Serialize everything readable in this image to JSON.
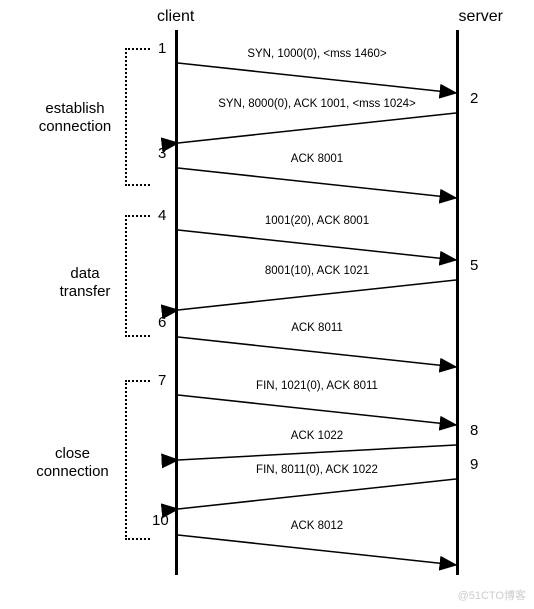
{
  "headers": {
    "client": "client",
    "server": "server"
  },
  "phases": {
    "establish": "establish connection",
    "data": "data transfer",
    "close": "close connection"
  },
  "steps": {
    "n1": "1",
    "n2": "2",
    "n3": "3",
    "n4": "4",
    "n5": "5",
    "n6": "6",
    "n7": "7",
    "n8": "8",
    "n9": "9",
    "n10": "10"
  },
  "messages": {
    "m1": "SYN, 1000(0), <mss 1460>",
    "m2": "SYN, 8000(0), ACK 1001, <mss 1024>",
    "m3": "ACK 8001",
    "m4": "1001(20), ACK 8001",
    "m5": "8001(10), ACK 1021",
    "m6": "ACK 8011",
    "m7": "FIN, 1021(0), ACK 8011",
    "m8": "ACK 1022",
    "m9": "FIN, 8011(0), ACK 1022",
    "m10": "ACK 8012"
  },
  "watermark": "@51CTO博客",
  "chart_data": {
    "type": "sequence-diagram",
    "title": "TCP Connection Lifecycle",
    "participants": [
      "client",
      "server"
    ],
    "phases": [
      {
        "name": "establish connection",
        "messages": [
          {
            "step": 1,
            "from": "client",
            "to": "server",
            "text": "SYN, 1000(0), <mss 1460>"
          },
          {
            "step": 2,
            "from": "server",
            "to": "client",
            "text": "SYN, 8000(0), ACK 1001, <mss 1024>"
          },
          {
            "step": 3,
            "from": "client",
            "to": "server",
            "text": "ACK 8001"
          }
        ]
      },
      {
        "name": "data transfer",
        "messages": [
          {
            "step": 4,
            "from": "client",
            "to": "server",
            "text": "1001(20), ACK 8001"
          },
          {
            "step": 5,
            "from": "server",
            "to": "client",
            "text": "8001(10), ACK 1021"
          },
          {
            "step": 6,
            "from": "client",
            "to": "server",
            "text": "ACK 8011"
          }
        ]
      },
      {
        "name": "close connection",
        "messages": [
          {
            "step": 7,
            "from": "client",
            "to": "server",
            "text": "FIN, 1021(0), ACK 8011"
          },
          {
            "step": 8,
            "from": "server",
            "to": "client",
            "text": "ACK 1022"
          },
          {
            "step": 9,
            "from": "server",
            "to": "client",
            "text": "FIN, 8011(0), ACK 1022"
          },
          {
            "step": 10,
            "from": "client",
            "to": "server",
            "text": "ACK 8012"
          }
        ]
      }
    ]
  }
}
